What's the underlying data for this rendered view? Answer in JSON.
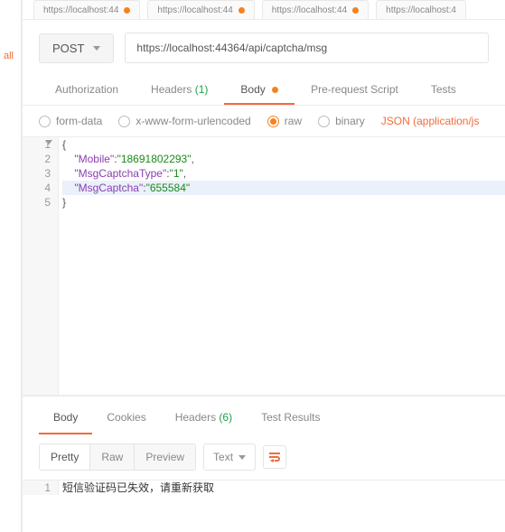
{
  "sidebar": {
    "label": "all"
  },
  "browserTabs": [
    {
      "title": "https://localhost:44"
    },
    {
      "title": "https://localhost:44"
    },
    {
      "title": "https://localhost:44"
    },
    {
      "title": "https://localhost:4"
    }
  ],
  "request": {
    "method": "POST",
    "url": "https://localhost:44364/api/captcha/msg"
  },
  "reqTabs": {
    "authorization": "Authorization",
    "headers": "Headers",
    "headersCount": "(1)",
    "body": "Body",
    "prerequest": "Pre-request Script",
    "tests": "Tests"
  },
  "bodyOptions": {
    "formdata": "form-data",
    "urlencoded": "x-www-form-urlencoded",
    "raw": "raw",
    "binary": "binary",
    "contentType": "JSON (application/js"
  },
  "editor": {
    "lines": [
      "1",
      "2",
      "3",
      "4",
      "5"
    ],
    "json": {
      "open": "{",
      "k1": "\"Mobile\"",
      "v1": "\"18691802293\"",
      "k2": "\"MsgCaptchaType\"",
      "v2": "\"1\"",
      "k3": "\"MsgCaptcha\"",
      "v3": "\"655584\"",
      "close": "}"
    }
  },
  "respTabs": {
    "body": "Body",
    "cookies": "Cookies",
    "headers": "Headers",
    "headersCount": "(6)",
    "testResults": "Test Results"
  },
  "respControls": {
    "pretty": "Pretty",
    "raw": "Raw",
    "preview": "Preview",
    "format": "Text"
  },
  "response": {
    "line1No": "1",
    "line1": "短信验证码已失效，请重新获取"
  }
}
